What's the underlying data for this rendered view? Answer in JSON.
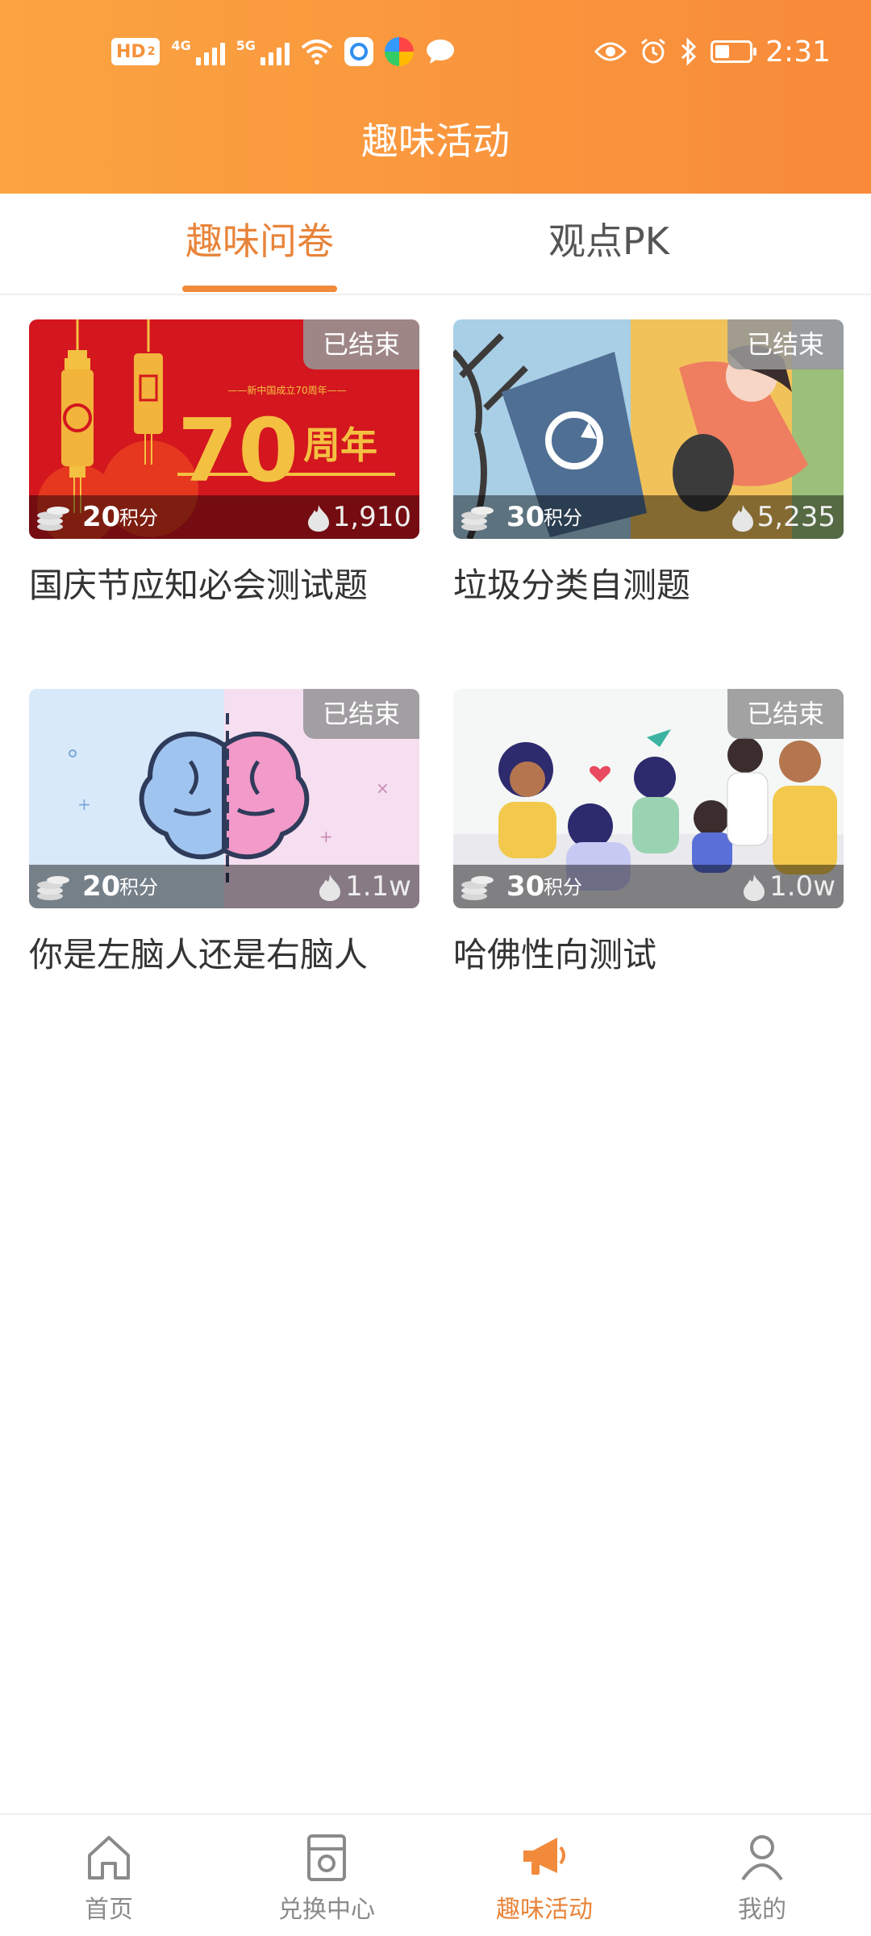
{
  "status_bar": {
    "network_hd": "HD",
    "sim_slot": "2",
    "network_4g": "4G",
    "network_5g": "5G",
    "time": "2:31",
    "icons": [
      "hd-icon",
      "signal-4g-icon",
      "signal-5g-icon",
      "wifi-icon",
      "app-browser-icon",
      "app-gallery-icon",
      "message-icon",
      "eye-icon",
      "alarm-icon",
      "bluetooth-icon",
      "battery-icon"
    ]
  },
  "header": {
    "title": "趣味活动"
  },
  "tabs": [
    {
      "label": "趣味问卷",
      "active": true
    },
    {
      "label": "观点PK",
      "active": false
    }
  ],
  "cards": [
    {
      "title": "国庆节应知必会测试题",
      "status": "已结束",
      "points": "20",
      "points_label": "积分",
      "views": "1,910",
      "image": "national-day-70th-anniversary-banner",
      "banner_small": "——新中国成立70周年——",
      "banner_big": "70",
      "banner_suffix": "周年"
    },
    {
      "title": "垃圾分类自测题",
      "status": "已结束",
      "points": "30",
      "points_label": "积分",
      "views": "5,235",
      "image": "garbage-recycling-illustration"
    },
    {
      "title": "你是左脑人还是右脑人",
      "status": "已结束",
      "points": "20",
      "points_label": "积分",
      "views": "1.1w",
      "image": "left-right-brain-illustration"
    },
    {
      "title": "哈佛性向测试",
      "status": "已结束",
      "points": "30",
      "points_label": "积分",
      "views": "1.0w",
      "image": "group-of-people-illustration"
    }
  ],
  "bottom_nav": [
    {
      "label": "首页",
      "icon": "home-icon",
      "active": false
    },
    {
      "label": "兑换中心",
      "icon": "exchange-icon",
      "active": false
    },
    {
      "label": "趣味活动",
      "icon": "megaphone-icon",
      "active": true
    },
    {
      "label": "我的",
      "icon": "user-icon",
      "active": false
    }
  ],
  "colors": {
    "accent": "#f28a3c",
    "header_start": "#fba441",
    "header_end": "#f88a3a",
    "text": "#333333",
    "inactive": "#8a8a8a"
  }
}
